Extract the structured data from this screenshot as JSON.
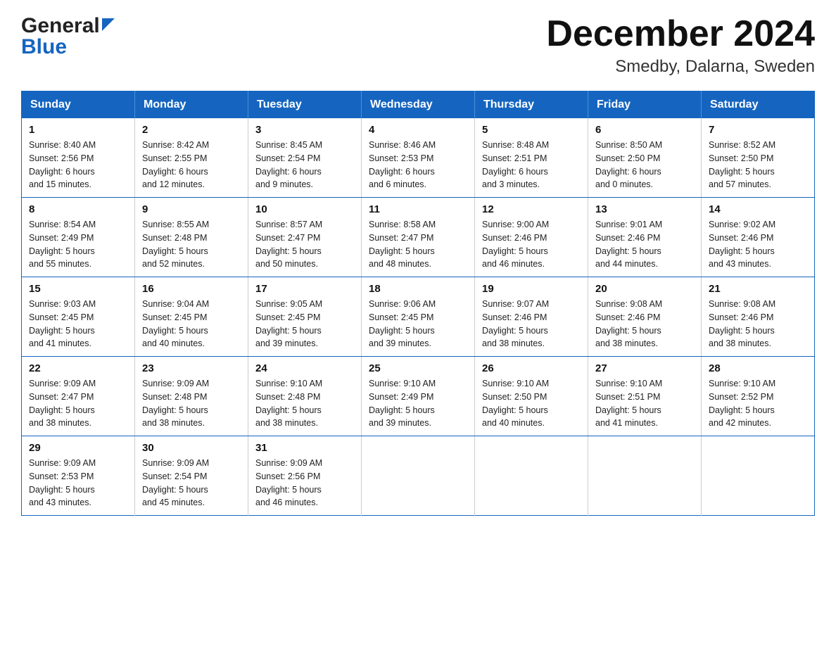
{
  "logo": {
    "general": "General",
    "blue": "Blue"
  },
  "title": {
    "month_year": "December 2024",
    "location": "Smedby, Dalarna, Sweden"
  },
  "headers": [
    "Sunday",
    "Monday",
    "Tuesday",
    "Wednesday",
    "Thursday",
    "Friday",
    "Saturday"
  ],
  "weeks": [
    [
      {
        "day": "1",
        "sunrise": "8:40 AM",
        "sunset": "2:56 PM",
        "daylight": "6 hours and 15 minutes."
      },
      {
        "day": "2",
        "sunrise": "8:42 AM",
        "sunset": "2:55 PM",
        "daylight": "6 hours and 12 minutes."
      },
      {
        "day": "3",
        "sunrise": "8:45 AM",
        "sunset": "2:54 PM",
        "daylight": "6 hours and 9 minutes."
      },
      {
        "day": "4",
        "sunrise": "8:46 AM",
        "sunset": "2:53 PM",
        "daylight": "6 hours and 6 minutes."
      },
      {
        "day": "5",
        "sunrise": "8:48 AM",
        "sunset": "2:51 PM",
        "daylight": "6 hours and 3 minutes."
      },
      {
        "day": "6",
        "sunrise": "8:50 AM",
        "sunset": "2:50 PM",
        "daylight": "6 hours and 0 minutes."
      },
      {
        "day": "7",
        "sunrise": "8:52 AM",
        "sunset": "2:50 PM",
        "daylight": "5 hours and 57 minutes."
      }
    ],
    [
      {
        "day": "8",
        "sunrise": "8:54 AM",
        "sunset": "2:49 PM",
        "daylight": "5 hours and 55 minutes."
      },
      {
        "day": "9",
        "sunrise": "8:55 AM",
        "sunset": "2:48 PM",
        "daylight": "5 hours and 52 minutes."
      },
      {
        "day": "10",
        "sunrise": "8:57 AM",
        "sunset": "2:47 PM",
        "daylight": "5 hours and 50 minutes."
      },
      {
        "day": "11",
        "sunrise": "8:58 AM",
        "sunset": "2:47 PM",
        "daylight": "5 hours and 48 minutes."
      },
      {
        "day": "12",
        "sunrise": "9:00 AM",
        "sunset": "2:46 PM",
        "daylight": "5 hours and 46 minutes."
      },
      {
        "day": "13",
        "sunrise": "9:01 AM",
        "sunset": "2:46 PM",
        "daylight": "5 hours and 44 minutes."
      },
      {
        "day": "14",
        "sunrise": "9:02 AM",
        "sunset": "2:46 PM",
        "daylight": "5 hours and 43 minutes."
      }
    ],
    [
      {
        "day": "15",
        "sunrise": "9:03 AM",
        "sunset": "2:45 PM",
        "daylight": "5 hours and 41 minutes."
      },
      {
        "day": "16",
        "sunrise": "9:04 AM",
        "sunset": "2:45 PM",
        "daylight": "5 hours and 40 minutes."
      },
      {
        "day": "17",
        "sunrise": "9:05 AM",
        "sunset": "2:45 PM",
        "daylight": "5 hours and 39 minutes."
      },
      {
        "day": "18",
        "sunrise": "9:06 AM",
        "sunset": "2:45 PM",
        "daylight": "5 hours and 39 minutes."
      },
      {
        "day": "19",
        "sunrise": "9:07 AM",
        "sunset": "2:46 PM",
        "daylight": "5 hours and 38 minutes."
      },
      {
        "day": "20",
        "sunrise": "9:08 AM",
        "sunset": "2:46 PM",
        "daylight": "5 hours and 38 minutes."
      },
      {
        "day": "21",
        "sunrise": "9:08 AM",
        "sunset": "2:46 PM",
        "daylight": "5 hours and 38 minutes."
      }
    ],
    [
      {
        "day": "22",
        "sunrise": "9:09 AM",
        "sunset": "2:47 PM",
        "daylight": "5 hours and 38 minutes."
      },
      {
        "day": "23",
        "sunrise": "9:09 AM",
        "sunset": "2:48 PM",
        "daylight": "5 hours and 38 minutes."
      },
      {
        "day": "24",
        "sunrise": "9:10 AM",
        "sunset": "2:48 PM",
        "daylight": "5 hours and 38 minutes."
      },
      {
        "day": "25",
        "sunrise": "9:10 AM",
        "sunset": "2:49 PM",
        "daylight": "5 hours and 39 minutes."
      },
      {
        "day": "26",
        "sunrise": "9:10 AM",
        "sunset": "2:50 PM",
        "daylight": "5 hours and 40 minutes."
      },
      {
        "day": "27",
        "sunrise": "9:10 AM",
        "sunset": "2:51 PM",
        "daylight": "5 hours and 41 minutes."
      },
      {
        "day": "28",
        "sunrise": "9:10 AM",
        "sunset": "2:52 PM",
        "daylight": "5 hours and 42 minutes."
      }
    ],
    [
      {
        "day": "29",
        "sunrise": "9:09 AM",
        "sunset": "2:53 PM",
        "daylight": "5 hours and 43 minutes."
      },
      {
        "day": "30",
        "sunrise": "9:09 AM",
        "sunset": "2:54 PM",
        "daylight": "5 hours and 45 minutes."
      },
      {
        "day": "31",
        "sunrise": "9:09 AM",
        "sunset": "2:56 PM",
        "daylight": "5 hours and 46 minutes."
      },
      null,
      null,
      null,
      null
    ]
  ],
  "labels": {
    "sunrise": "Sunrise:",
    "sunset": "Sunset:",
    "daylight": "Daylight:"
  }
}
